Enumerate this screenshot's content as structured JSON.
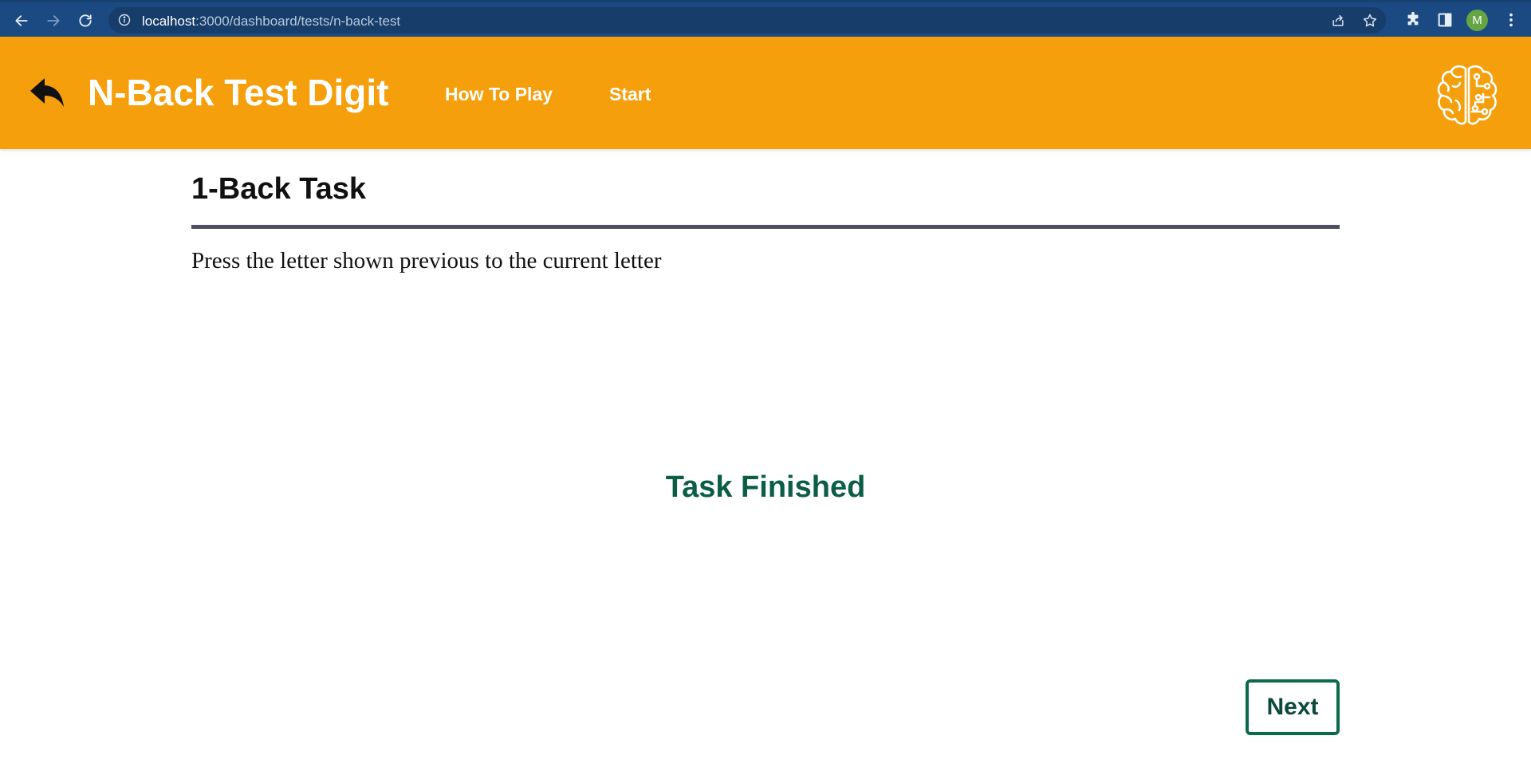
{
  "browser": {
    "url_host": "localhost",
    "url_path": ":3000/dashboard/tests/n-back-test",
    "profile_initial": "M"
  },
  "header": {
    "title": "N-Back Test Digit",
    "nav": [
      {
        "label": "How To Play"
      },
      {
        "label": "Start"
      }
    ],
    "background_color": "#f59f0c"
  },
  "main": {
    "task_title": "1-Back Task",
    "instruction": "Press the letter shown previous to the current letter",
    "status": "Task Finished",
    "status_color": "#0b5e45",
    "next_label": "Next"
  },
  "icons": {
    "back": "back-arrow-icon",
    "forward": "forward-arrow-icon",
    "reload": "reload-icon",
    "site_info": "info-icon",
    "share": "share-icon",
    "bookmark": "star-icon",
    "extensions": "puzzle-icon",
    "side_panel": "side-panel-icon",
    "menu": "kebab-menu-icon",
    "app_back": "reply-arrow-icon",
    "logo": "brain-circuit-icon"
  }
}
